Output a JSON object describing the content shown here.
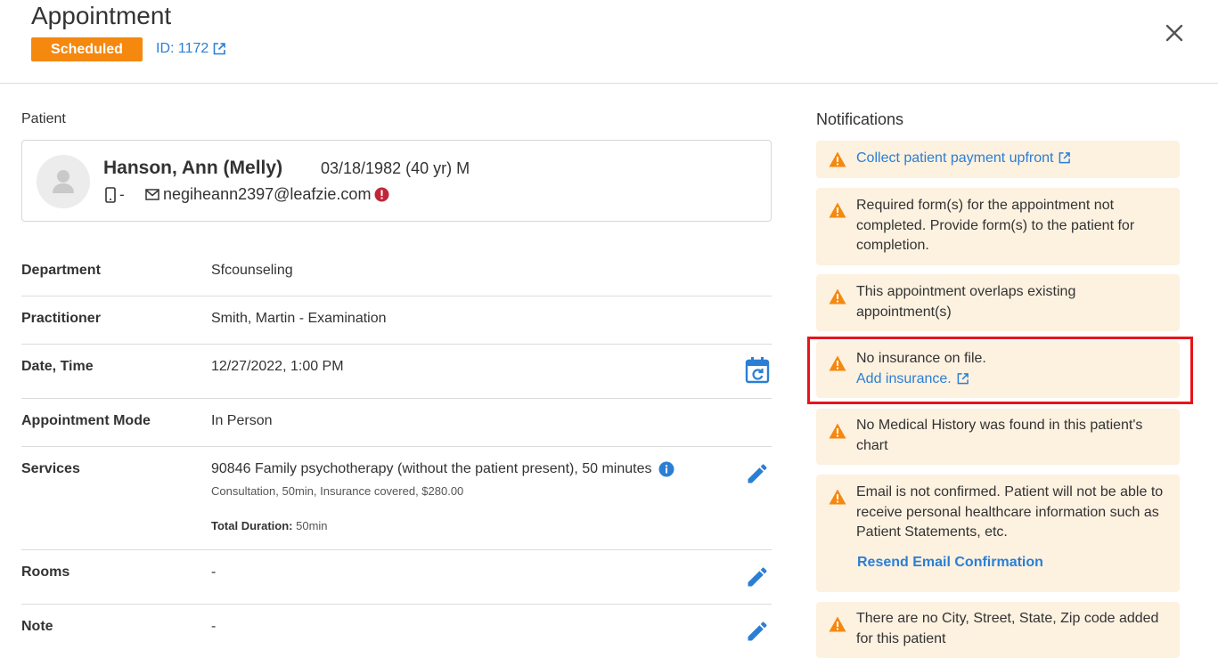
{
  "header": {
    "title": "Appointment",
    "status": "Scheduled",
    "id_label": "ID: 1172"
  },
  "patient": {
    "section_label": "Patient",
    "name": "Hanson, Ann (Melly)",
    "dob": "03/18/1982 (40 yr) M",
    "phone": "-",
    "email": "negiheann2397@leafzie.com"
  },
  "details": {
    "department": {
      "label": "Department",
      "value": "Sfcounseling"
    },
    "practitioner": {
      "label": "Practitioner",
      "value": "Smith, Martin - Examination"
    },
    "datetime": {
      "label": "Date, Time",
      "value": "12/27/2022, 1:00 PM"
    },
    "mode": {
      "label": "Appointment Mode",
      "value": "In Person"
    },
    "services": {
      "label": "Services",
      "value": "90846 Family psychotherapy (without the patient present), 50 minutes",
      "sub": "Consultation, 50min, Insurance covered, $280.00",
      "total_label": "Total Duration:",
      "total_value": "50min"
    },
    "rooms": {
      "label": "Rooms",
      "value": "-"
    },
    "note": {
      "label": "Note",
      "value": "-"
    }
  },
  "notifications": {
    "title": "Notifications",
    "items": [
      {
        "link": "Collect patient payment upfront"
      },
      {
        "text": "Required form(s) for the appointment not completed. Provide form(s) to the patient for completion."
      },
      {
        "text": "This appointment overlaps existing appointment(s)"
      },
      {
        "text": "No insurance on file.",
        "link": "Add insurance."
      },
      {
        "text": "No Medical History was found in this patient's chart"
      },
      {
        "text": "Email is not confirmed. Patient will not be able to receive personal healthcare information such as Patient Statements, etc.",
        "link": "Resend Email Confirmation"
      },
      {
        "text": "There are no City, Street, State, Zip code added for this patient"
      }
    ]
  },
  "colors": {
    "accent": "#2a7fd4",
    "status_badge": "#f5880f",
    "notification_bg": "#fdf1e0",
    "warning": "#f5880f",
    "highlight": "#e8141b",
    "error": "#c0263a"
  }
}
